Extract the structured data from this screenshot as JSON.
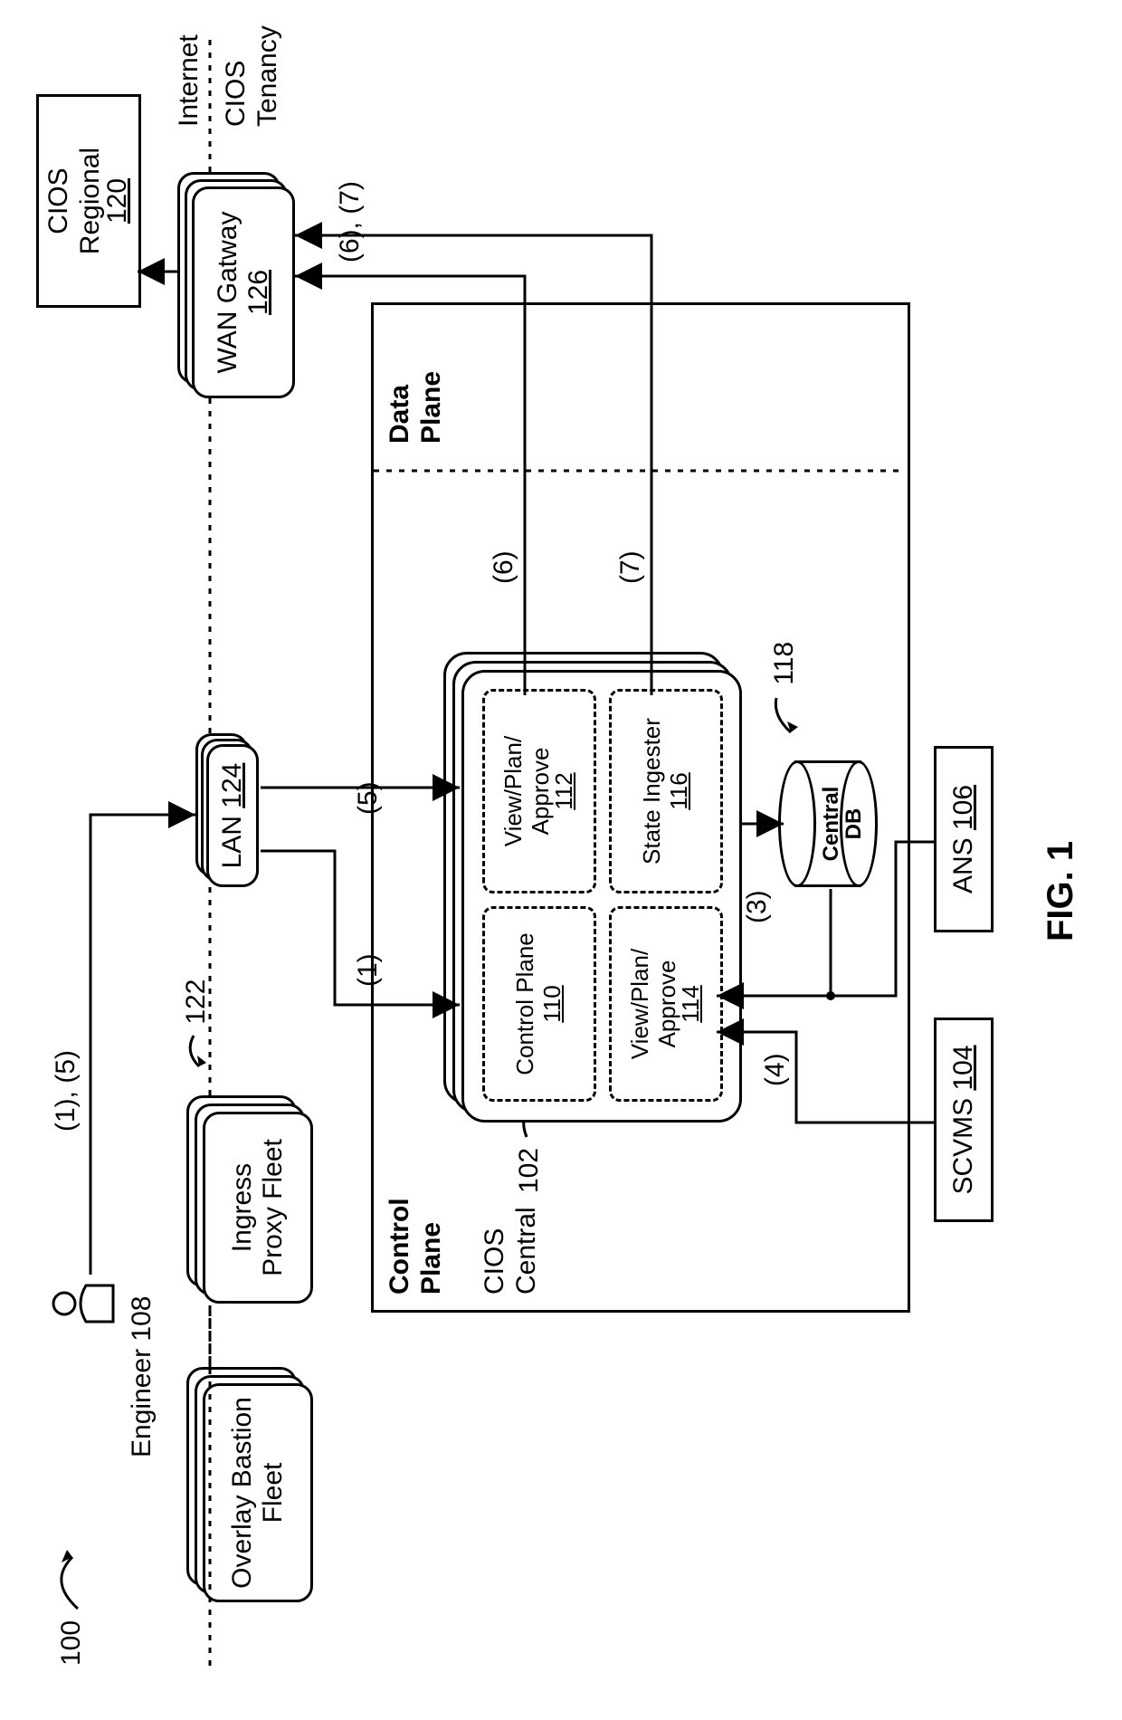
{
  "figure": {
    "ref": "100",
    "caption": "FIG. 1"
  },
  "actors": {
    "engineer": "Engineer 108"
  },
  "fleet": {
    "overlay_bastion": "Overlay Bastion\nFleet",
    "ingress_proxy": "Ingress\nProxy Fleet",
    "ingress_ref": "122",
    "lan": "LAN",
    "lan_ref": "124",
    "wan": "WAN Gatway",
    "wan_ref": "126",
    "cios_regional": "CIOS\nRegional",
    "cios_regional_ref": "120"
  },
  "zones": {
    "internet": "Internet",
    "tenancy": "CIOS\nTenancy",
    "control_plane": "Control\nPlane",
    "data_plane": "Data\nPlane"
  },
  "cios_central": {
    "label": "CIOS\nCentral",
    "ref": "102",
    "control_plane_box": "Control Plane",
    "control_plane_box_ref": "110",
    "vpa1": "View/Plan/\nApprove",
    "vpa1_ref": "112",
    "vpa2": "View/Plan/\nApprove",
    "vpa2_ref": "114",
    "state_ingester": "State Ingester",
    "state_ingester_ref": "116",
    "db_label": "Central\nDB",
    "db_ref": "118"
  },
  "ext": {
    "scvms": "SCVMS",
    "scvms_ref": "104",
    "ans": "ANS",
    "ans_ref": "106"
  },
  "edge_labels": {
    "top_1_5": "(1), (5)",
    "e1": "(1)",
    "e3": "(3)",
    "e4": "(4)",
    "e5": "(5)",
    "e6": "(6)",
    "e7": "(7)",
    "e6_7": "(6), (7)"
  }
}
